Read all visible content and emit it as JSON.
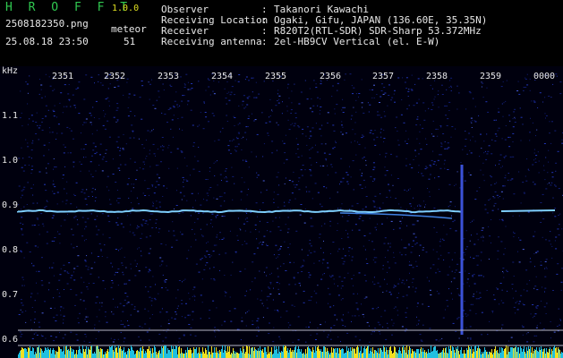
{
  "header": {
    "app_name": "H R O F F T",
    "version": "1.0.0",
    "file_name": "2508182350.png",
    "datetime": "25.08.18 23:50",
    "meteor_label": "meteor",
    "meteor_count": "51"
  },
  "station": [
    {
      "key": "Observer",
      "value": "Takanori Kawachi"
    },
    {
      "key": "Receiving Location",
      "value": "Ogaki, Gifu, JAPAN (136.60E, 35.35N)"
    },
    {
      "key": "Receiver",
      "value": "R820T2(RTL-SDR) SDR-Sharp 53.372MHz"
    },
    {
      "key": "Receiving antenna",
      "value": "2el-HB9CV Vertical (el. E-W)"
    }
  ],
  "spectrogram": {
    "unit_label": "kHz",
    "time_labels": [
      "2351",
      "2352",
      "2353",
      "2354",
      "2355",
      "2356",
      "2357",
      "2358",
      "2359",
      "0000"
    ],
    "freq_labels": [
      "1.1",
      "1.0",
      "0.9",
      "0.8",
      "0.7",
      "0.6"
    ],
    "colors": {
      "background": "#000010",
      "noise": "#1a2aa8",
      "signal": "#7fd0ff",
      "level_bar": "#f0e020",
      "level_low": "#20c0e0"
    }
  }
}
